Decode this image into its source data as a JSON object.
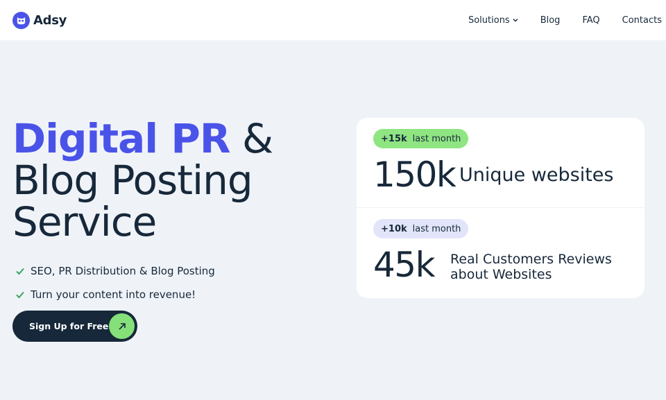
{
  "header": {
    "brand": "Adsy",
    "nav": [
      {
        "label": "Solutions",
        "has_dropdown": true
      },
      {
        "label": "Blog"
      },
      {
        "label": "FAQ"
      },
      {
        "label": "Contacts"
      }
    ]
  },
  "hero": {
    "title_accent": "Digital PR",
    "title_rest_1": " &",
    "title_line_2": "Blog Posting",
    "title_line_3": "Service",
    "features": [
      "SEO, PR Distribution & Blog Posting",
      "Turn your content into revenue!"
    ],
    "cta_label": "Sign Up for Free"
  },
  "stats": [
    {
      "badge_value": "+15k",
      "badge_text": "last month",
      "number": "150k",
      "label": "Unique websites"
    },
    {
      "badge_value": "+10k",
      "badge_text": "last month",
      "number": "45k",
      "label": "Real Customers Reviews about Websites"
    }
  ],
  "colors": {
    "brand": "#4a53e8",
    "dark": "#16283a",
    "green_badge": "#8fe582",
    "lilac_badge": "#e2e5fa",
    "cta_arrow": "#86e07a",
    "background": "#eff3f8"
  },
  "icons": {
    "logo": "owl-logo-icon",
    "dropdown": "chevron-down-icon",
    "check": "check-icon",
    "cta": "arrow-up-right-icon"
  }
}
